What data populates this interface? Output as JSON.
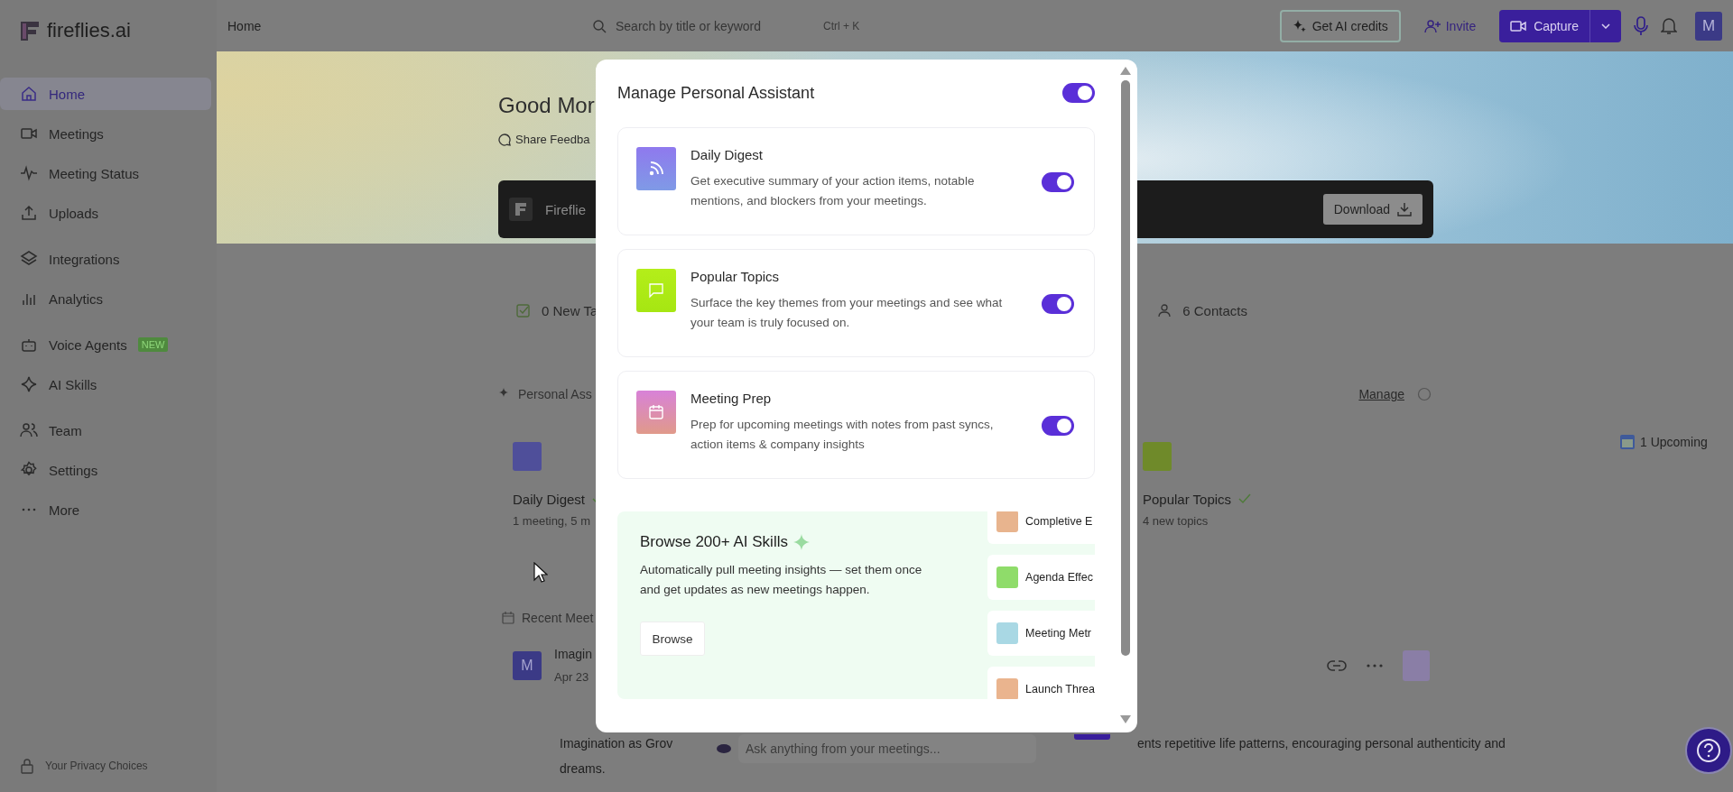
{
  "sidebar": {
    "logo": "fireflies.ai",
    "groups": [
      [
        {
          "label": "Home",
          "selected": true
        },
        {
          "label": "Meetings",
          "selected": false
        },
        {
          "label": "Meeting Status",
          "selected": false
        },
        {
          "label": "Uploads",
          "selected": false
        }
      ],
      [
        {
          "label": "Integrations",
          "selected": false
        },
        {
          "label": "Analytics",
          "selected": false
        }
      ],
      [
        {
          "label": "Voice Agents",
          "selected": false,
          "badge": "NEW"
        },
        {
          "label": "AI Skills",
          "selected": false
        }
      ],
      [
        {
          "label": "Team",
          "selected": false
        },
        {
          "label": "Settings",
          "selected": false
        },
        {
          "label": "More",
          "selected": false
        }
      ]
    ],
    "footer": "Your Privacy Choices"
  },
  "topbar": {
    "title": "Home",
    "search": {
      "placeholder": "Search by title or keyword",
      "shortcut": "Ctrl + K"
    },
    "buttons": [
      {
        "label": "Get AI credits",
        "kind": "outline"
      },
      {
        "label": "Invite",
        "kind": "link"
      },
      {
        "label": "Capture",
        "kind": "primary"
      }
    ],
    "avatar": "M"
  },
  "home": {
    "greeting": "Good Mor",
    "feedback": "Share Feedba",
    "banner": {
      "title": "Fireflie",
      "button": "Download"
    },
    "stats": [
      "0 New Ta",
      "6 Contacts"
    ],
    "assistant": {
      "title": "Personal Ass",
      "manage": "Manage",
      "upcoming": "1 Upcoming",
      "cards": [
        {
          "title": "Daily Digest",
          "subtitle": "1 meeting, 5 m",
          "checked": true,
          "kind": "digest"
        },
        {
          "title": "Popular Topics",
          "subtitle": "4 new topics",
          "checked": true,
          "kind": "topics"
        }
      ]
    },
    "recent": {
      "title": "Recent Meet",
      "meeting": {
        "avatar": "M",
        "title": "Imagin",
        "date": "Apr 23"
      },
      "summary": [
        "Imagination as Grov",
        "ents repetitive life patterns, encouraging personal authenticity and",
        "dreams."
      ]
    },
    "chat": {
      "placeholder": "Ask anything from your meetings..."
    }
  },
  "modal": {
    "title": "Manage Personal Assistant",
    "on": true,
    "features": [
      {
        "kind": "digest",
        "title": "Daily Digest",
        "description": "Get executive summary of your action items, notable mentions, and blockers from your meetings.",
        "on": true
      },
      {
        "kind": "topics",
        "title": "Popular Topics",
        "description": "Surface the key themes from your meetings and see what your team is truly focused on.",
        "on": true
      },
      {
        "kind": "prep",
        "title": "Meeting Prep",
        "description": "Prep for upcoming meetings with notes from past syncs, action items & company insights",
        "on": true
      }
    ],
    "browse": {
      "title": "Browse 200+ AI Skills",
      "description": "Automatically pull meeting insights — set them once and get updates as new meetings happen.",
      "button": "Browse",
      "skills": [
        {
          "label": "Completive E",
          "color": "#e8b48e"
        },
        {
          "label": "Agenda Effec",
          "color": "#8fdc6a"
        },
        {
          "label": "Meeting Metr",
          "color": "#a9d8e4"
        },
        {
          "label": "Launch Threa",
          "color": "#eab48e"
        }
      ]
    }
  }
}
